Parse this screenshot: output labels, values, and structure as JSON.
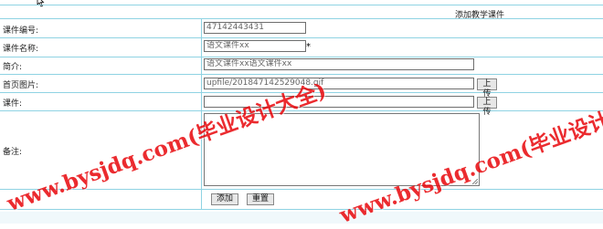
{
  "form": {
    "title": "添加教学课件",
    "rows": [
      {
        "label": "课件编号:",
        "value": "47142443431"
      },
      {
        "label": "课件名称:",
        "value": "语文课件xx"
      },
      {
        "label": "简介:",
        "value": "语文课件xx语文课件xx"
      },
      {
        "label": "首页图片:",
        "value": "upfile/201847142529048.gif"
      },
      {
        "label": "课件:",
        "value": ""
      },
      {
        "label": "备注:",
        "value": ""
      }
    ],
    "required_mark": "*",
    "upload_label": "上传",
    "add_label": "添加",
    "reset_label": "重置"
  },
  "watermark": {
    "text": "www.bysjdq.com(毕业设计大全)",
    "color": "#e8070b"
  }
}
